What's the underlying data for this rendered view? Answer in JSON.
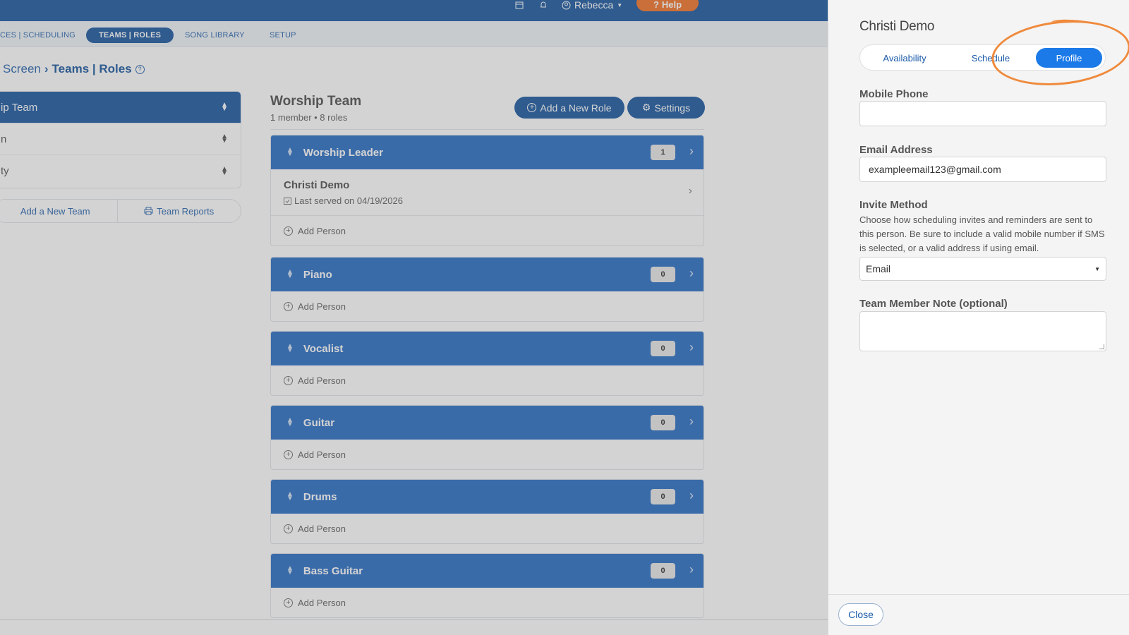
{
  "topbar": {
    "user_name": "Rebecca",
    "help_label": "Help"
  },
  "nav": {
    "items": [
      {
        "label": "CES | SCHEDULING"
      },
      {
        "label": "TEAMS | ROLES"
      },
      {
        "label": "SONG LIBRARY"
      },
      {
        "label": "SETUP"
      }
    ]
  },
  "breadcrumb": {
    "parent": "Screen",
    "current": "Teams | Roles"
  },
  "teams": {
    "items": [
      {
        "label": "ip Team"
      },
      {
        "label": "n"
      },
      {
        "label": "ty"
      }
    ],
    "add_label": "Add a New Team",
    "reports_label": "Team Reports"
  },
  "worship_team": {
    "title": "Worship Team",
    "subtitle": "1 member • 8 roles",
    "add_role_label": "Add a New Role",
    "settings_label": "Settings"
  },
  "roles": [
    {
      "name": "Worship Leader",
      "count": "1"
    },
    {
      "name": "Piano",
      "count": "0"
    },
    {
      "name": "Vocalist",
      "count": "0"
    },
    {
      "name": "Guitar",
      "count": "0"
    },
    {
      "name": "Drums",
      "count": "0"
    },
    {
      "name": "Bass Guitar",
      "count": "0"
    }
  ],
  "member": {
    "name": "Christi Demo",
    "last_served": "Last served on 04/19/2026"
  },
  "add_person_label": "Add Person",
  "panel": {
    "title": "Christi Demo",
    "tabs": [
      {
        "label": "Availability"
      },
      {
        "label": "Schedule"
      },
      {
        "label": "Profile"
      }
    ],
    "mobile_label": "Mobile Phone",
    "mobile_value": "",
    "email_label": "Email Address",
    "email_value": "exampleemail123@gmail.com",
    "invite_label": "Invite Method",
    "invite_help": "Choose how scheduling invites and reminders are sent to this person. Be sure to include a valid mobile number if SMS is selected, or a valid address if using email.",
    "invite_value": "Email",
    "note_label": "Team Member Note (optional)",
    "note_value": "",
    "close_label": "Close"
  },
  "colors": {
    "brand_dark": "#0b4d9a",
    "role_header": "#1c64c0",
    "active_tab": "#1c7ae8",
    "annotation": "#ef8a3c",
    "help": "#f26a1b"
  }
}
